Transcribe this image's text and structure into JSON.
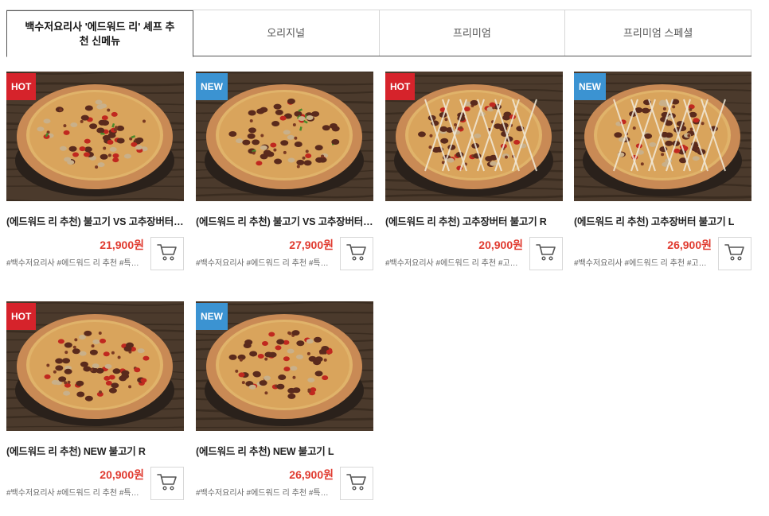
{
  "tabs": [
    {
      "label": "백수저요리사 '에드워드 리' 셰프 추천 신메뉴",
      "active": true
    },
    {
      "label": "오리지널",
      "active": false
    },
    {
      "label": "프리미엄",
      "active": false
    },
    {
      "label": "프리미엄 스페셜",
      "active": false
    }
  ],
  "products": [
    {
      "badge": "HOT",
      "name": "(에드워드 리 추천) 불고기 VS 고추장버터불고기 R",
      "price": "21,900원",
      "tags": "#백수저요리사 #에드워드 리 추천 #특별한 맛",
      "cart_icon": "cart-icon"
    },
    {
      "badge": "NEW",
      "name": "(에드워드 리 추천) 불고기 VS 고추장버터불고기 L",
      "price": "27,900원",
      "tags": "#백수저요리사 #에드워드 리 추천 #특별한 맛",
      "cart_icon": "cart-icon"
    },
    {
      "badge": "HOT",
      "name": "(에드워드 리 추천) 고추장버터 불고기 R",
      "price": "20,900원",
      "tags": "#백수저요리사 #에드워드 리 추천 #고추장버터",
      "cart_icon": "cart-icon"
    },
    {
      "badge": "NEW",
      "name": "(에드워드 리 추천) 고추장버터 불고기 L",
      "price": "26,900원",
      "tags": "#백수저요리사 #에드워드 리 추천 #고추장버터",
      "cart_icon": "cart-icon"
    },
    {
      "badge": "HOT",
      "name": "(에드워드 리 추천) NEW 불고기 R",
      "price": "20,900원",
      "tags": "#백수저요리사 #에드워드 리 추천 #특별한 맛",
      "cart_icon": "cart-icon"
    },
    {
      "badge": "NEW",
      "name": "(에드워드 리 추천) NEW 불고기 L",
      "price": "26,900원",
      "tags": "#백수저요리사 #에드워드 리 추천 #특별한 맛",
      "cart_icon": "cart-icon"
    }
  ],
  "colors": {
    "hot": "#d6232b",
    "new": "#3b93d2",
    "price": "#e03a2f"
  }
}
